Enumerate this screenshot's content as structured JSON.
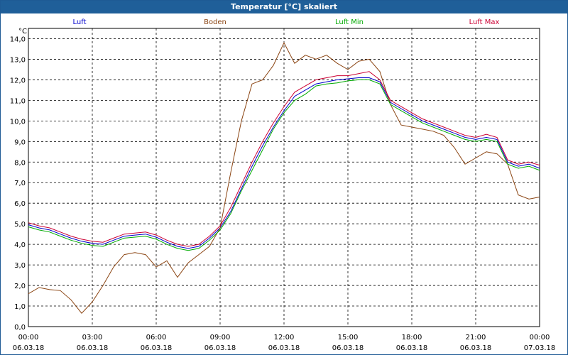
{
  "window": {
    "title": "Temperatur [°C] skaliert"
  },
  "chart_data": {
    "type": "line",
    "ylabel": "°C",
    "ylim": [
      0,
      14.5
    ],
    "xlim": [
      "2018-03-06T00:00",
      "2018-03-07T00:00"
    ],
    "grid": true,
    "legend_position": "top",
    "yticks": [
      "0,0",
      "1,0",
      "2,0",
      "3,0",
      "4,0",
      "5,0",
      "6,0",
      "7,0",
      "8,0",
      "9,0",
      "10,0",
      "11,0",
      "12,0",
      "13,0",
      "14,0"
    ],
    "xticks": [
      {
        "time": "00:00",
        "date": "06.03.18"
      },
      {
        "time": "03:00",
        "date": "06.03.18"
      },
      {
        "time": "06:00",
        "date": "06.03.18"
      },
      {
        "time": "09:00",
        "date": "06.03.18"
      },
      {
        "time": "12:00",
        "date": "06.03.18"
      },
      {
        "time": "15:00",
        "date": "06.03.18"
      },
      {
        "time": "18:00",
        "date": "06.03.18"
      },
      {
        "time": "21:00",
        "date": "06.03.18"
      },
      {
        "time": "00:00",
        "date": "07.03.18"
      }
    ],
    "x_hours": [
      0,
      0.5,
      1,
      1.5,
      2,
      2.5,
      3,
      3.5,
      4,
      4.5,
      5,
      5.5,
      6,
      6.5,
      7,
      7.5,
      8,
      8.5,
      9,
      9.5,
      10,
      10.5,
      11,
      11.5,
      12,
      12.5,
      13,
      13.5,
      14,
      14.5,
      15,
      15.5,
      16,
      16.5,
      17,
      17.5,
      18,
      18.5,
      19,
      19.5,
      20,
      20.5,
      21,
      21.5,
      22,
      22.5,
      23,
      23.5,
      24
    ],
    "series": [
      {
        "name": "Luft",
        "color": "#0000cc",
        "values": [
          4.95,
          4.8,
          4.7,
          4.5,
          4.3,
          4.15,
          4.05,
          4.0,
          4.2,
          4.4,
          4.45,
          4.5,
          4.35,
          4.1,
          3.9,
          3.8,
          3.9,
          4.3,
          4.8,
          5.6,
          6.7,
          7.8,
          8.8,
          9.7,
          10.5,
          11.2,
          11.5,
          11.8,
          11.9,
          12.0,
          12.05,
          12.1,
          12.1,
          11.9,
          10.9,
          10.6,
          10.3,
          10.0,
          9.8,
          9.6,
          9.4,
          9.2,
          9.1,
          9.2,
          9.1,
          8.0,
          7.8,
          7.9,
          7.7
        ]
      },
      {
        "name": "Boden",
        "color": "#8b4513",
        "values": [
          1.6,
          1.9,
          1.8,
          1.75,
          1.3,
          0.65,
          1.2,
          2.0,
          2.9,
          3.5,
          3.6,
          3.5,
          2.9,
          3.2,
          2.4,
          3.1,
          3.5,
          3.9,
          4.8,
          7.5,
          10.0,
          11.8,
          12.0,
          12.7,
          13.8,
          12.8,
          13.2,
          13.0,
          13.2,
          12.8,
          12.5,
          12.9,
          13.0,
          12.4,
          10.8,
          9.8,
          9.7,
          9.6,
          9.5,
          9.3,
          8.7,
          7.9,
          8.2,
          8.5,
          8.4,
          7.9,
          6.4,
          6.2,
          6.3
        ]
      },
      {
        "name": "Luft Min",
        "color": "#00aa00",
        "values": [
          4.85,
          4.7,
          4.6,
          4.4,
          4.2,
          4.05,
          3.95,
          3.9,
          4.1,
          4.3,
          4.35,
          4.4,
          4.25,
          4.0,
          3.8,
          3.7,
          3.8,
          4.2,
          4.7,
          5.5,
          6.6,
          7.6,
          8.6,
          9.6,
          10.4,
          11.0,
          11.3,
          11.7,
          11.8,
          11.85,
          11.95,
          12.0,
          12.0,
          11.8,
          10.8,
          10.5,
          10.2,
          9.9,
          9.7,
          9.5,
          9.3,
          9.1,
          9.0,
          9.1,
          9.0,
          7.9,
          7.7,
          7.8,
          7.6
        ]
      },
      {
        "name": "Luft Max",
        "color": "#cc0033",
        "values": [
          5.05,
          4.9,
          4.8,
          4.6,
          4.4,
          4.25,
          4.15,
          4.1,
          4.3,
          4.5,
          4.55,
          4.6,
          4.45,
          4.2,
          4.0,
          3.9,
          4.0,
          4.4,
          4.9,
          5.8,
          6.9,
          8.0,
          9.0,
          9.9,
          10.7,
          11.4,
          11.7,
          12.0,
          12.1,
          12.2,
          12.2,
          12.3,
          12.4,
          12.0,
          11.0,
          10.7,
          10.4,
          10.1,
          9.9,
          9.7,
          9.5,
          9.3,
          9.2,
          9.35,
          9.2,
          8.1,
          7.9,
          8.0,
          7.85
        ]
      }
    ]
  }
}
